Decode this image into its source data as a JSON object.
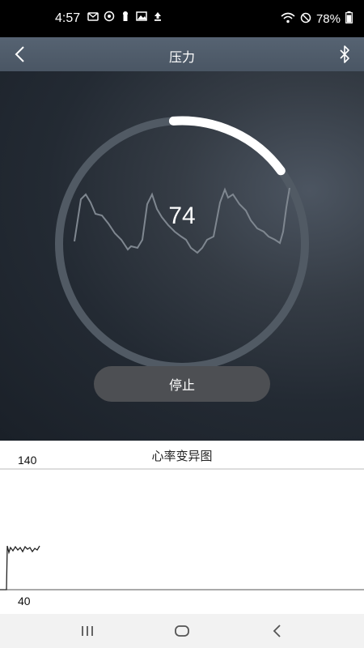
{
  "status_bar": {
    "time": "4:57",
    "battery": "78%",
    "notification_icons": [
      "mail-icon",
      "sync-icon",
      "keyhole-icon",
      "image-icon",
      "upload-icon"
    ]
  },
  "title_bar": {
    "title": "压力"
  },
  "gauge": {
    "value": "74",
    "progress_fraction": 0.16,
    "ring_color": "#515a64",
    "progress_color": "#ffffff"
  },
  "stop_button": {
    "label": "停止"
  },
  "hrv": {
    "title": "心率变异图",
    "y_max": "140",
    "y_min": "40"
  },
  "colors": {
    "title_bar": "#4f5b69",
    "button": "#4d4f53"
  }
}
